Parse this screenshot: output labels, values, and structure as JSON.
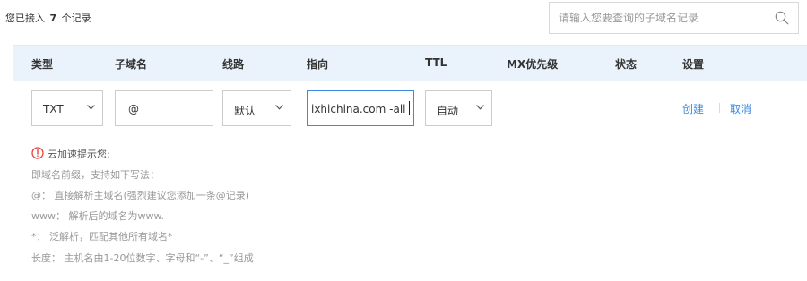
{
  "summary": {
    "prefix": "您已接入",
    "count": "7",
    "suffix": "个记录"
  },
  "search": {
    "placeholder": "请输入您要查询的子域名记录"
  },
  "table": {
    "headers": [
      "类型",
      "子域名",
      "线路",
      "指向",
      "TTL",
      "MX优先级",
      "状态",
      "设置"
    ]
  },
  "new_record": {
    "type": "TXT",
    "subdomain": "@",
    "line": "默认",
    "target": "ixhichina.com -all",
    "ttl": "自动"
  },
  "actions": {
    "create": "创建",
    "cancel": "取消"
  },
  "tips": {
    "title": "云加速提示您:",
    "lines": [
      "即域名前缀，支持如下写法：",
      "@： 直接解析主域名(强烈建议您添加一条@记录)",
      "www： 解析后的域名为www.",
      "*： 泛解析，匹配其他所有域名*",
      "长度： 主机名由1-20位数字、字母和“-”、“_”组成"
    ]
  },
  "colors": {
    "accent": "#3d8be0",
    "header_bg": "#eaf3fb",
    "warning": "#e64340"
  }
}
